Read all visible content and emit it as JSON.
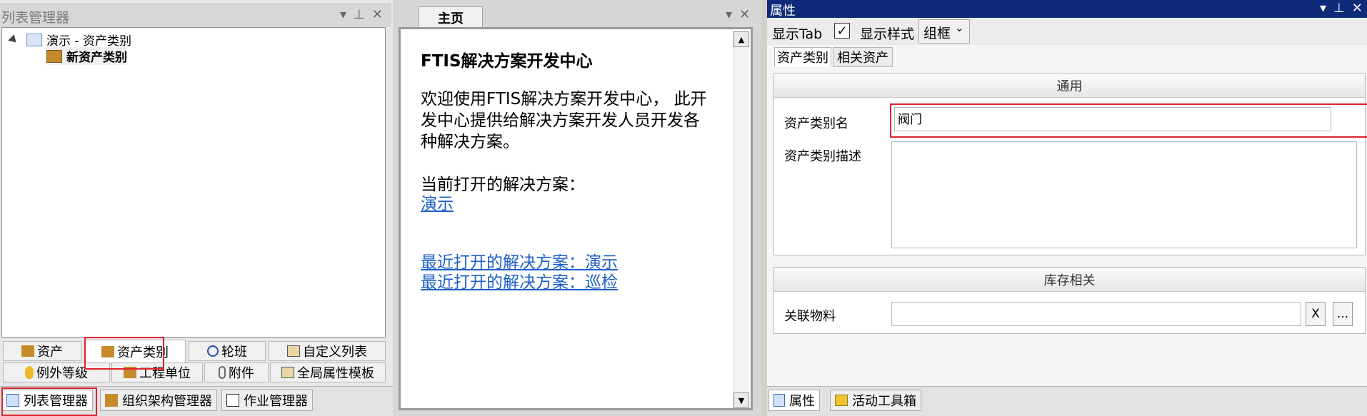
{
  "left_panel": {
    "title": "列表管理器",
    "tree": {
      "root_label": "演示 - 资产类别",
      "child_label": "新资产类别"
    },
    "tabs_row1": [
      "资产",
      "资产类别",
      "轮班",
      "自定义列表"
    ],
    "tabs_row2": [
      "例外等级",
      "工程单位",
      "附件",
      "全局属性模板"
    ],
    "bottom_tabs": [
      "列表管理器",
      "组织架构管理器",
      "作业管理器"
    ]
  },
  "middle_panel": {
    "tab_label": "主页",
    "heading": "FTIS解决方案开发中心",
    "welcome_line1": "欢迎使用FTIS解决方案开发中心， 此开",
    "welcome_line2": "发中心提供给解决方案开发人员开发各",
    "welcome_line3": "种解决方案。",
    "current_label": "当前打开的解决方案：",
    "current_link": "演示",
    "recent_link1": "最近打开的解决方案：演示",
    "recent_link2": "最近打开的解决方案：巡检"
  },
  "right_panel": {
    "title": "属性",
    "toolbar": {
      "show_tab_label": "显示Tab",
      "show_tab_checked": "✓",
      "show_style_label": "显示样式",
      "style_value": "组框",
      "chevron": "⌄"
    },
    "tabs": [
      "资产类别",
      "相关资产"
    ],
    "general": {
      "header": "通用",
      "name_label": "资产类别名",
      "name_value": "阀门",
      "desc_label": "资产类别描述",
      "desc_value": ""
    },
    "inventory": {
      "header": "库存相关",
      "material_label": "关联物料",
      "material_value": "",
      "clear_btn": "X",
      "browse_btn": "..."
    },
    "bottom_tabs": [
      "属性",
      "活动工具箱"
    ]
  },
  "colors": {
    "highlight_red": "#e0222d",
    "title_blue": "#0e2a78",
    "link_blue": "#1e5fc8"
  }
}
